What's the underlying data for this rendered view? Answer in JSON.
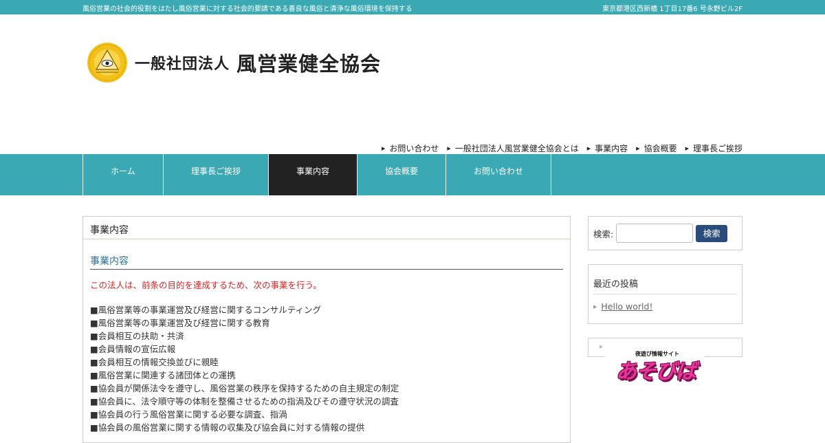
{
  "topbar": {
    "tagline": "風俗営業の社会的役割をはたし風俗営業に対する社会的要請である善良な風俗と清浄な風俗環境を保持する",
    "address": "東京都港区西新橋 1丁目17番6 号永野ビル2F"
  },
  "logo": {
    "emblem": "eye-of-providence-emblem",
    "org_type": "一般社団法人",
    "org_name": "風営業健全協会"
  },
  "subnav": [
    {
      "label": "お問い合わせ"
    },
    {
      "label": "一般社団法人風営業健全協会とは"
    },
    {
      "label": "事業内容"
    },
    {
      "label": "協会概要"
    },
    {
      "label": "理事長ご挨拶"
    }
  ],
  "mainnav": [
    {
      "label": "ホーム",
      "active": false
    },
    {
      "label": "理事長ご挨拶",
      "active": false
    },
    {
      "label": "事業内容",
      "active": true
    },
    {
      "label": "協会概要",
      "active": false
    },
    {
      "label": "お問い合わせ",
      "active": false
    }
  ],
  "content": {
    "page_title": "事業内容",
    "heading": "事業内容",
    "lead": "この法人は、前条の目的を達成するため、次の事業を行う。",
    "items": [
      "■風俗営業等の事業運営及び経営に関するコンサルティング",
      "■風俗営業等の事業運営及び経営に関する教育",
      "■会員相互の扶助・共済",
      "■会員情報の宣伝広報",
      "■会員相互の情報交換並びに親睦",
      "■風俗営業に関連する諸団体との運携",
      "■協会員が関係法令を遵守し、風俗営業の秩序を保持するための自主規定の制定",
      "■協会員に、法令順守等の体制を整備させるための指渦及びその遵守状況の調査",
      "■協会員の行う風俗営業に関する必要な調査、指渦",
      "■協会員の風俗営業に関する情報の収集及び協会員に対する情報の提供"
    ]
  },
  "sidebar": {
    "search": {
      "label": "検索:",
      "button": "検索",
      "value": ""
    },
    "recent": {
      "title": "最近の投稿",
      "posts": [
        "Hello world!"
      ]
    },
    "banner": {
      "small_text": "夜遊び情報サイト",
      "big_text": "あそびば"
    }
  },
  "colors": {
    "teal": "#3aa9b4",
    "active_tab": "#222222",
    "heading_blue": "#2a6f9a",
    "lead_red": "#e02020",
    "search_button": "#2a4c7c",
    "banner_pink": "#e8369a"
  }
}
